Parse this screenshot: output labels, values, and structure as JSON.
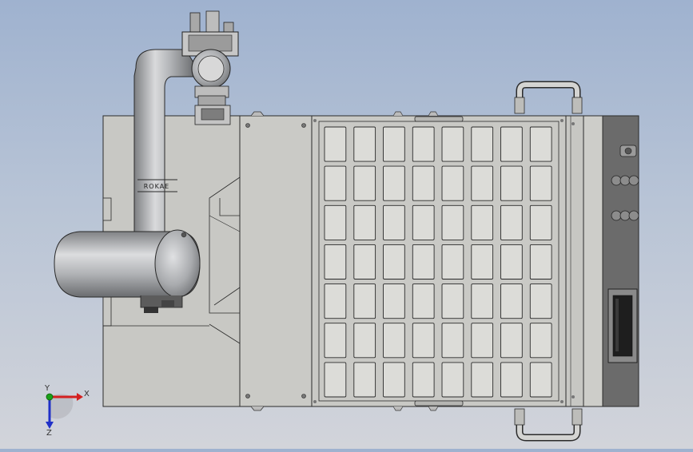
{
  "viewport": {
    "background_top": "#9fb2cf",
    "background_bottom": "#d2d4da"
  },
  "robot": {
    "brand_label": "ROKAE",
    "body_color": "#b9bbbe"
  },
  "tray": {
    "rows": 7,
    "columns": 8,
    "panel_color": "#c9c9c5",
    "slot_color": "#dcdcd8"
  },
  "end_panel": {
    "color": "#6b6b6b"
  },
  "axis_triad": {
    "x_label": "X",
    "y_label": "Y",
    "z_label": "Z",
    "x_color": "#d42020",
    "y_color": "#19a019",
    "z_color": "#2030c8"
  }
}
